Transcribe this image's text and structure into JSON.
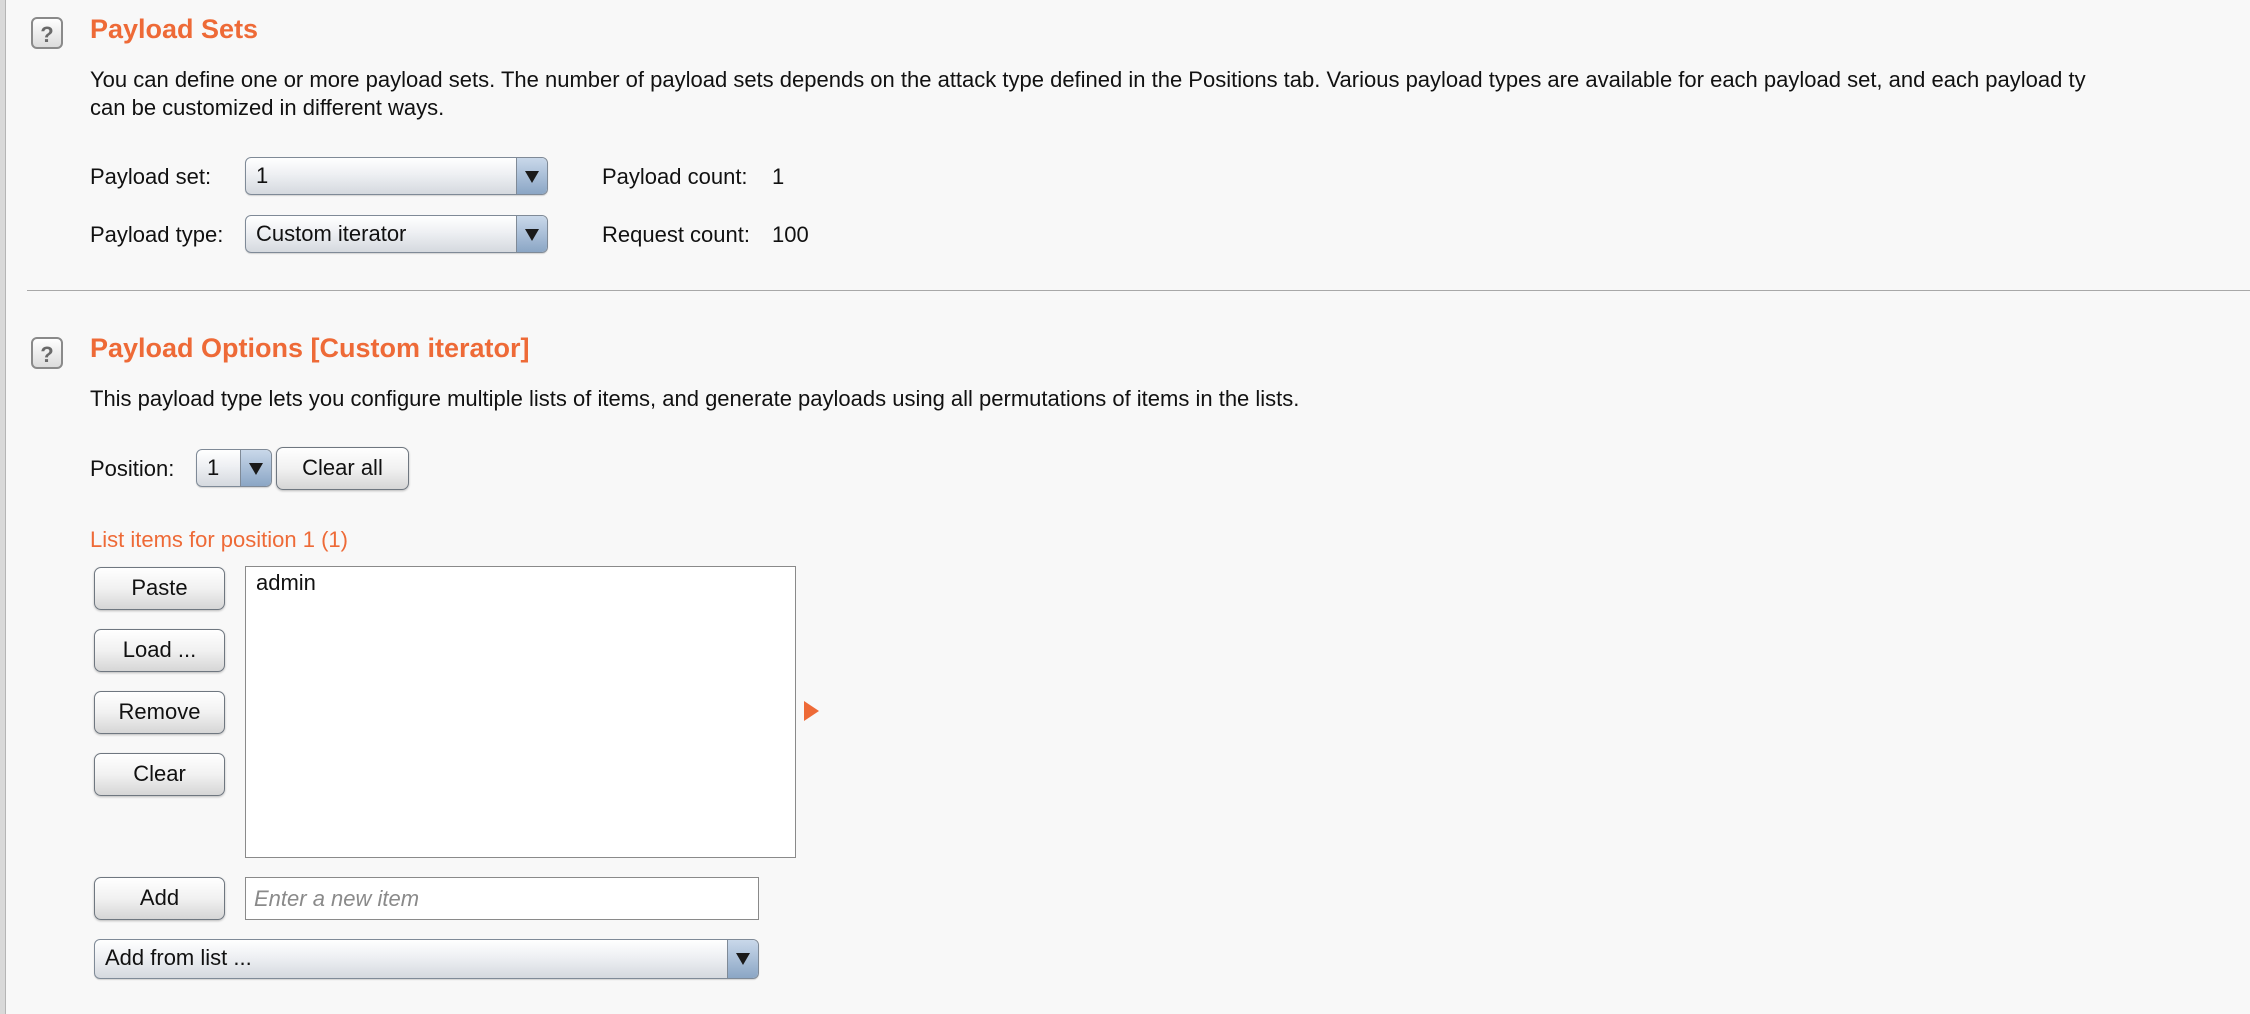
{
  "payload_sets": {
    "title": "Payload Sets",
    "description_line1": "You can define one or more payload sets. The number of payload sets depends on the attack type defined in the Positions tab. Various payload types are available for each payload set, and each payload ty",
    "description_line2": "can be customized in different ways.",
    "payload_set_label": "Payload set:",
    "payload_set_value": "1",
    "payload_type_label": "Payload type:",
    "payload_type_value": "Custom iterator",
    "payload_count_label": "Payload count:",
    "payload_count_value": "1",
    "request_count_label": "Request count:",
    "request_count_value": "100"
  },
  "payload_options": {
    "title": "Payload Options [Custom iterator]",
    "description": "This payload type lets you configure multiple lists of items, and generate payloads using all permutations of items in the lists.",
    "position_label": "Position:",
    "position_value": "1",
    "clear_all_label": "Clear all",
    "list_heading": "List items for position 1 (1)",
    "buttons": {
      "paste": "Paste",
      "load": "Load ...",
      "remove": "Remove",
      "clear": "Clear",
      "add": "Add"
    },
    "list_items": [
      "admin"
    ],
    "new_item_placeholder": "Enter a new item",
    "add_from_list_value": "Add from list ..."
  },
  "icons": {
    "help": "help-icon",
    "dropdown": "chevron-down-icon",
    "expand": "expand-arrow-icon"
  },
  "colors": {
    "accent": "#ee6a37",
    "background": "#f8f8f8"
  }
}
